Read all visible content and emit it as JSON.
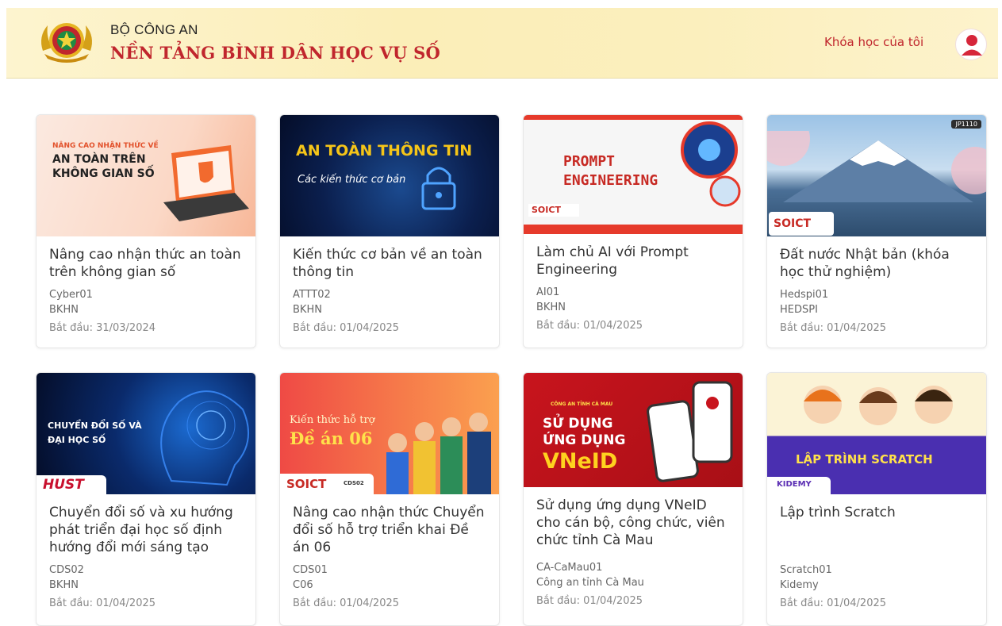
{
  "header": {
    "org": "BỘ CÔNG AN",
    "platform": "NỀN TẢNG BÌNH DÂN HỌC VỤ SỐ",
    "my_courses": "Khóa học của tôi"
  },
  "colors": {
    "brand_red": "#c0262d",
    "header_bg": "#fbeeb8"
  },
  "courses": [
    {
      "title": "Nâng cao nhận thức an toàn trên không gian số",
      "code": "Cyber01",
      "org": "BKHN",
      "start": "Bắt đầu: 31/03/2024",
      "thumb": {
        "l1": "NÂNG CAO NHẬN THỨC VỀ",
        "l2": "AN TOÀN TRÊN",
        "l3": "KHÔNG GIAN SỐ"
      }
    },
    {
      "title": "Kiến thức cơ bản về an toàn thông tin",
      "code": "ATTT02",
      "org": "BKHN",
      "start": "Bắt đầu: 01/04/2025",
      "thumb": {
        "l1": "AN TOÀN THÔNG TIN",
        "l2": "Các kiến thức cơ bản"
      }
    },
    {
      "title": "Làm chủ AI với Prompt Engineering",
      "code": "AI01",
      "org": "BKHN",
      "start": "Bắt đầu: 01/04/2025",
      "thumb": {
        "l1": "PROMPT",
        "l2": "ENGINEERING",
        "logo": "SOICT"
      }
    },
    {
      "title": "Đất nước Nhật bản (khóa học thử nghiệm)",
      "code": "Hedspi01",
      "org": "HEDSPI",
      "start": "Bắt đầu: 01/04/2025",
      "thumb": {
        "tag": "JP1110",
        "logo": "SOICT"
      }
    },
    {
      "title": "Chuyển đổi số và xu hướng phát triển đại học số định hướng đổi mới sáng tạo",
      "code": "CDS02",
      "org": "BKHN",
      "start": "Bắt đầu: 01/04/2025",
      "thumb": {
        "l1": "CHUYỂN ĐỔI SỐ VÀ",
        "l2": "ĐẠI HỌC SỐ",
        "logo": "HUST"
      }
    },
    {
      "title": "Nâng cao nhận thức Chuyển đổi số hỗ trợ triển khai Đề án 06",
      "code": "CDS01",
      "org": "C06",
      "start": "Bắt đầu: 01/04/2025",
      "thumb": {
        "l1": "Kiến thức hỗ trợ",
        "l2": "Đề án 06",
        "logo": "SOICT",
        "tag": "CDS02"
      }
    },
    {
      "title": "Sử dụng ứng dụng VNeID cho cán bộ, công chức, viên chức tỉnh Cà Mau",
      "code": "CA-CaMau01",
      "org": "Công an tỉnh Cà Mau",
      "start": "Bắt đầu: 01/04/2025",
      "thumb": {
        "l0": "CÔNG AN TỈNH CÀ MAU",
        "l1": "SỬ DỤNG",
        "l2": "ỨNG DỤNG",
        "l3": "VNeID"
      }
    },
    {
      "title": "Lập trình Scratch",
      "code": "Scratch01",
      "org": "Kidemy",
      "start": "Bắt đầu: 01/04/2025",
      "thumb": {
        "l1": "LẬP TRÌNH SCRATCH",
        "logo": "KIDEMY"
      }
    }
  ]
}
